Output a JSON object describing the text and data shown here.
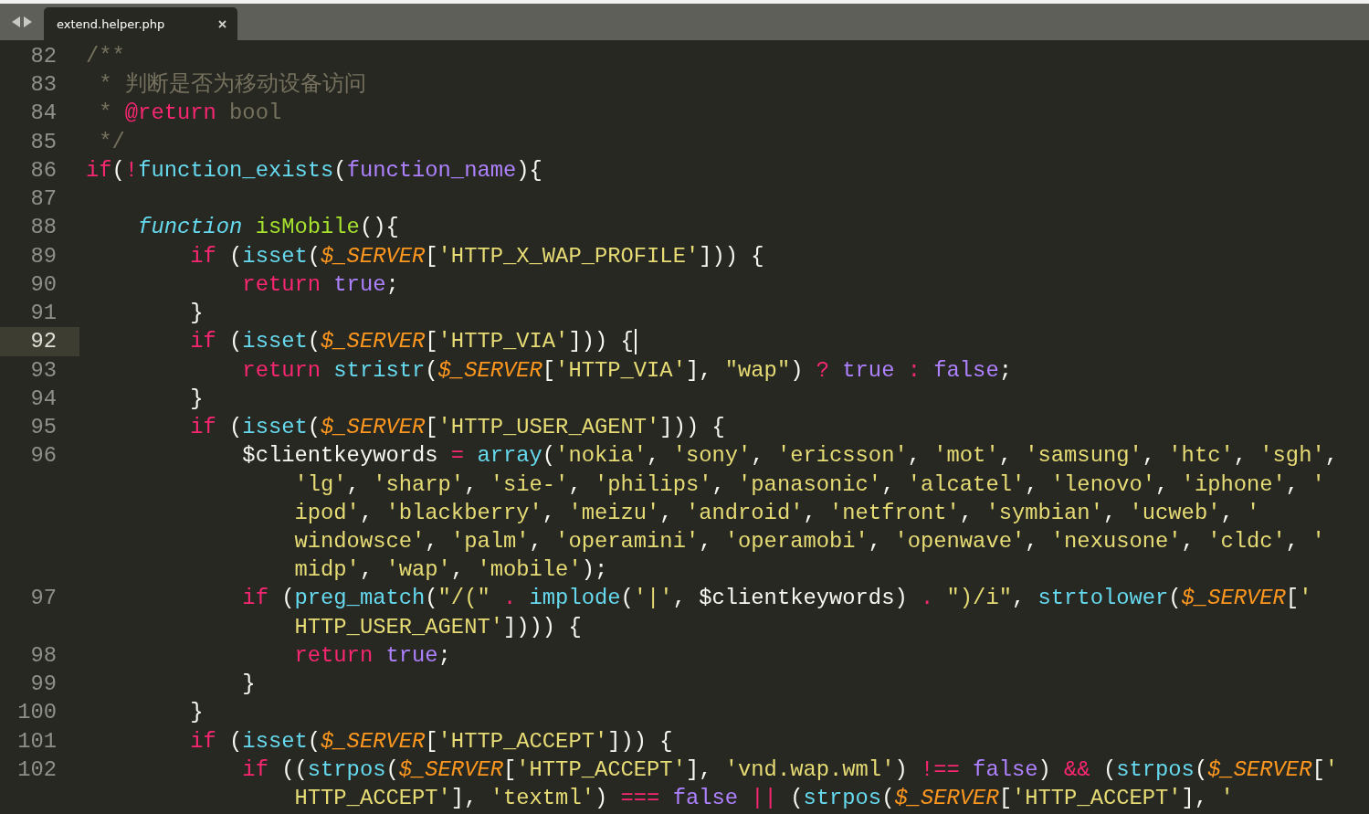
{
  "tabs": [
    {
      "label": "extend.helper.php",
      "selected": true
    }
  ],
  "lines": [
    {
      "number": "82",
      "current": false,
      "rows": [
        {
          "tokens": [
            {
              "kind": "cmt",
              "text": "/**"
            }
          ]
        }
      ]
    },
    {
      "number": "83",
      "current": false,
      "rows": [
        {
          "tokens": [
            {
              "kind": "cmtcont",
              "text": "* 判断是否为移动设备访问"
            }
          ]
        }
      ]
    },
    {
      "number": "84",
      "current": false,
      "rows": [
        {
          "tokens": [
            {
              "kind": "cmtcont",
              "text": "* "
            },
            {
              "kind": "tag",
              "text": "@return"
            },
            {
              "kind": "cmt",
              "text": " bool"
            }
          ]
        }
      ]
    },
    {
      "number": "85",
      "current": false,
      "rows": [
        {
          "tokens": [
            {
              "kind": "cmtcont",
              "text": "*/"
            }
          ]
        }
      ]
    },
    {
      "number": "86",
      "current": false,
      "rows": [
        {
          "tokens": [
            {
              "kind": "kw",
              "text": "if"
            },
            {
              "kind": "plain",
              "text": "("
            },
            {
              "kind": "op",
              "text": "!"
            },
            {
              "kind": "fn",
              "text": "function_exists"
            },
            {
              "kind": "plain",
              "text": "("
            },
            {
              "kind": "const",
              "text": "function_name"
            },
            {
              "kind": "plain",
              "text": "){"
            }
          ]
        }
      ],
      "children": [
        {
          "number": "87",
          "current": false
        },
        {
          "number": "88",
          "current": false,
          "rows": [
            {
              "tokens": [
                {
                  "kind": "storage",
                  "text": "function "
                },
                {
                  "kind": "def",
                  "text": "isMobile"
                },
                {
                  "kind": "plain",
                  "text": "(){"
                }
              ]
            }
          ],
          "children": [
            {
              "number": "89",
              "current": false,
              "rows": [
                {
                  "tokens": [
                    {
                      "kind": "kw",
                      "text": "if"
                    },
                    {
                      "kind": "plain",
                      "text": " ("
                    },
                    {
                      "kind": "fn",
                      "text": "isset"
                    },
                    {
                      "kind": "plain",
                      "text": "("
                    },
                    {
                      "kind": "var",
                      "text": "$_SERVER"
                    },
                    {
                      "kind": "plain",
                      "text": "["
                    },
                    {
                      "kind": "str",
                      "text": "'HTTP_X_WAP_PROFILE'"
                    },
                    {
                      "kind": "plain",
                      "text": "])) {"
                    }
                  ]
                }
              ],
              "children": [
                {
                  "number": "90",
                  "current": false,
                  "rows": [
                    {
                      "tokens": [
                        {
                          "kind": "kw",
                          "text": "return "
                        },
                        {
                          "kind": "const",
                          "text": "true"
                        },
                        {
                          "kind": "plain",
                          "text": ";"
                        }
                      ]
                    }
                  ]
                }
              ]
            },
            {
              "number": "91",
              "current": false,
              "rows": [
                {
                  "tokens": [
                    {
                      "kind": "plain",
                      "text": "}"
                    }
                  ]
                }
              ]
            },
            {
              "number": "92",
              "current": true,
              "rows": [
                {
                  "tokens": [
                    {
                      "kind": "kw",
                      "text": "if"
                    },
                    {
                      "kind": "plain",
                      "text": " ("
                    },
                    {
                      "kind": "fn",
                      "text": "isset"
                    },
                    {
                      "kind": "plain",
                      "text": "("
                    },
                    {
                      "kind": "var",
                      "text": "$_SERVER"
                    },
                    {
                      "kind": "plain",
                      "text": "["
                    },
                    {
                      "kind": "str",
                      "text": "'HTTP_VIA'"
                    },
                    {
                      "kind": "plain",
                      "text": "])) {"
                    }
                  ]
                }
              ],
              "children": [
                {
                  "number": "93",
                  "current": false,
                  "rows": [
                    {
                      "tokens": [
                        {
                          "kind": "kw",
                          "text": "return "
                        },
                        {
                          "kind": "fn",
                          "text": "stristr"
                        },
                        {
                          "kind": "plain",
                          "text": "("
                        },
                        {
                          "kind": "var",
                          "text": "$_SERVER"
                        },
                        {
                          "kind": "plain",
                          "text": "["
                        },
                        {
                          "kind": "str",
                          "text": "'HTTP_VIA'"
                        },
                        {
                          "kind": "plain",
                          "text": "], "
                        },
                        {
                          "kind": "str",
                          "text": "\"wap\""
                        },
                        {
                          "kind": "plain",
                          "text": ") "
                        },
                        {
                          "kind": "op",
                          "text": "? "
                        },
                        {
                          "kind": "const",
                          "text": "true "
                        },
                        {
                          "kind": "op",
                          "text": ": "
                        },
                        {
                          "kind": "const",
                          "text": "false"
                        },
                        {
                          "kind": "plain",
                          "text": ";"
                        }
                      ]
                    }
                  ]
                }
              ]
            },
            {
              "number": "94",
              "current": false,
              "rows": [
                {
                  "tokens": [
                    {
                      "kind": "plain",
                      "text": "}"
                    }
                  ]
                }
              ]
            },
            {
              "number": "95",
              "current": false,
              "rows": [
                {
                  "tokens": [
                    {
                      "kind": "kw",
                      "text": "if"
                    },
                    {
                      "kind": "plain",
                      "text": " ("
                    },
                    {
                      "kind": "fn",
                      "text": "isset"
                    },
                    {
                      "kind": "plain",
                      "text": "("
                    },
                    {
                      "kind": "var",
                      "text": "$_SERVER"
                    },
                    {
                      "kind": "plain",
                      "text": "["
                    },
                    {
                      "kind": "str",
                      "text": "'HTTP_USER_AGENT'"
                    },
                    {
                      "kind": "plain",
                      "text": "])) {"
                    }
                  ]
                }
              ],
              "children": [
                {
                  "number": "96",
                  "current": false,
                  "rows": [
                    {
                      "tokens": [
                        {
                          "kind": "plain",
                          "text": "$clientkeywords "
                        },
                        {
                          "kind": "op",
                          "text": "= "
                        },
                        {
                          "kind": "fn",
                          "text": "array"
                        },
                        {
                          "kind": "plain",
                          "text": "("
                        },
                        {
                          "kind": "str",
                          "text": "'nokia'"
                        },
                        {
                          "kind": "plain",
                          "text": ", "
                        },
                        {
                          "kind": "str",
                          "text": "'sony'"
                        },
                        {
                          "kind": "plain",
                          "text": ", "
                        },
                        {
                          "kind": "str",
                          "text": "'ericsson'"
                        },
                        {
                          "kind": "plain",
                          "text": ", "
                        },
                        {
                          "kind": "str",
                          "text": "'mot'"
                        },
                        {
                          "kind": "plain",
                          "text": ", "
                        },
                        {
                          "kind": "str",
                          "text": "'samsung'"
                        },
                        {
                          "kind": "plain",
                          "text": ", "
                        },
                        {
                          "kind": "str",
                          "text": "'htc'"
                        },
                        {
                          "kind": "plain",
                          "text": ", "
                        },
                        {
                          "kind": "str",
                          "text": "'sgh'"
                        },
                        {
                          "kind": "plain",
                          "text": ","
                        }
                      ]
                    },
                    {
                      "tokens": [
                        {
                          "kind": "str",
                          "text": "'lg'"
                        },
                        {
                          "kind": "plain",
                          "text": ", "
                        },
                        {
                          "kind": "str",
                          "text": "'sharp'"
                        },
                        {
                          "kind": "plain",
                          "text": ", "
                        },
                        {
                          "kind": "str",
                          "text": "'sie-'"
                        },
                        {
                          "kind": "plain",
                          "text": ", "
                        },
                        {
                          "kind": "str",
                          "text": "'philips'"
                        },
                        {
                          "kind": "plain",
                          "text": ", "
                        },
                        {
                          "kind": "str",
                          "text": "'panasonic'"
                        },
                        {
                          "kind": "plain",
                          "text": ", "
                        },
                        {
                          "kind": "str",
                          "text": "'alcatel'"
                        },
                        {
                          "kind": "plain",
                          "text": ", "
                        },
                        {
                          "kind": "str",
                          "text": "'lenovo'"
                        },
                        {
                          "kind": "plain",
                          "text": ", "
                        },
                        {
                          "kind": "str",
                          "text": "'iphone'"
                        },
                        {
                          "kind": "plain",
                          "text": ", "
                        },
                        {
                          "kind": "str",
                          "text": "'"
                        }
                      ]
                    },
                    {
                      "tokens": [
                        {
                          "kind": "str",
                          "text": "ipod'"
                        },
                        {
                          "kind": "plain",
                          "text": ", "
                        },
                        {
                          "kind": "str",
                          "text": "'blackberry'"
                        },
                        {
                          "kind": "plain",
                          "text": ", "
                        },
                        {
                          "kind": "str",
                          "text": "'meizu'"
                        },
                        {
                          "kind": "plain",
                          "text": ", "
                        },
                        {
                          "kind": "str",
                          "text": "'android'"
                        },
                        {
                          "kind": "plain",
                          "text": ", "
                        },
                        {
                          "kind": "str",
                          "text": "'netfront'"
                        },
                        {
                          "kind": "plain",
                          "text": ", "
                        },
                        {
                          "kind": "str",
                          "text": "'symbian'"
                        },
                        {
                          "kind": "plain",
                          "text": ", "
                        },
                        {
                          "kind": "str",
                          "text": "'ucweb'"
                        },
                        {
                          "kind": "plain",
                          "text": ", "
                        },
                        {
                          "kind": "str",
                          "text": "'"
                        }
                      ]
                    },
                    {
                      "tokens": [
                        {
                          "kind": "str",
                          "text": "windowsce'"
                        },
                        {
                          "kind": "plain",
                          "text": ", "
                        },
                        {
                          "kind": "str",
                          "text": "'palm'"
                        },
                        {
                          "kind": "plain",
                          "text": ", "
                        },
                        {
                          "kind": "str",
                          "text": "'operamini'"
                        },
                        {
                          "kind": "plain",
                          "text": ", "
                        },
                        {
                          "kind": "str",
                          "text": "'operamobi'"
                        },
                        {
                          "kind": "plain",
                          "text": ", "
                        },
                        {
                          "kind": "str",
                          "text": "'openwave'"
                        },
                        {
                          "kind": "plain",
                          "text": ", "
                        },
                        {
                          "kind": "str",
                          "text": "'nexusone'"
                        },
                        {
                          "kind": "plain",
                          "text": ", "
                        },
                        {
                          "kind": "str",
                          "text": "'cldc'"
                        },
                        {
                          "kind": "plain",
                          "text": ", "
                        },
                        {
                          "kind": "str",
                          "text": "'"
                        }
                      ]
                    },
                    {
                      "tokens": [
                        {
                          "kind": "str",
                          "text": "midp'"
                        },
                        {
                          "kind": "plain",
                          "text": ", "
                        },
                        {
                          "kind": "str",
                          "text": "'wap'"
                        },
                        {
                          "kind": "plain",
                          "text": ", "
                        },
                        {
                          "kind": "str",
                          "text": "'mobile'"
                        },
                        {
                          "kind": "plain",
                          "text": ");"
                        }
                      ]
                    }
                  ]
                },
                {
                  "number": "97",
                  "current": false,
                  "rows": [
                    {
                      "tokens": [
                        {
                          "kind": "kw",
                          "text": "if"
                        },
                        {
                          "kind": "plain",
                          "text": " ("
                        },
                        {
                          "kind": "fn",
                          "text": "preg_match"
                        },
                        {
                          "kind": "plain",
                          "text": "("
                        },
                        {
                          "kind": "str",
                          "text": "\"/(\" "
                        },
                        {
                          "kind": "op",
                          "text": ". "
                        },
                        {
                          "kind": "fn",
                          "text": "implode"
                        },
                        {
                          "kind": "plain",
                          "text": "("
                        },
                        {
                          "kind": "str",
                          "text": "'|'"
                        },
                        {
                          "kind": "plain",
                          "text": ", $clientkeywords) "
                        },
                        {
                          "kind": "op",
                          "text": ". "
                        },
                        {
                          "kind": "str",
                          "text": "\")/i\""
                        },
                        {
                          "kind": "plain",
                          "text": ", "
                        },
                        {
                          "kind": "fn",
                          "text": "strtolower"
                        },
                        {
                          "kind": "plain",
                          "text": "("
                        },
                        {
                          "kind": "var",
                          "text": "$_SERVER"
                        },
                        {
                          "kind": "plain",
                          "text": "["
                        },
                        {
                          "kind": "str",
                          "text": "'"
                        }
                      ]
                    },
                    {
                      "tokens": [
                        {
                          "kind": "str",
                          "text": "HTTP_USER_AGENT'"
                        },
                        {
                          "kind": "plain",
                          "text": "]))) {"
                        }
                      ]
                    }
                  ],
                  "children": [
                    {
                      "number": "98",
                      "current": false,
                      "rows": [
                        {
                          "tokens": [
                            {
                              "kind": "kw",
                              "text": "return "
                            },
                            {
                              "kind": "const",
                              "text": "true"
                            },
                            {
                              "kind": "plain",
                              "text": ";"
                            }
                          ]
                        }
                      ]
                    }
                  ]
                },
                {
                  "number": "99",
                  "current": false,
                  "rows": [
                    {
                      "tokens": [
                        {
                          "kind": "plain",
                          "text": "}"
                        }
                      ]
                    }
                  ]
                }
              ]
            },
            {
              "number": "100",
              "current": false,
              "rows": [
                {
                  "tokens": [
                    {
                      "kind": "plain",
                      "text": "}"
                    }
                  ]
                }
              ]
            },
            {
              "number": "101",
              "current": false,
              "rows": [
                {
                  "tokens": [
                    {
                      "kind": "kw",
                      "text": "if"
                    },
                    {
                      "kind": "plain",
                      "text": " ("
                    },
                    {
                      "kind": "fn",
                      "text": "isset"
                    },
                    {
                      "kind": "plain",
                      "text": "("
                    },
                    {
                      "kind": "var",
                      "text": "$_SERVER"
                    },
                    {
                      "kind": "plain",
                      "text": "["
                    },
                    {
                      "kind": "str",
                      "text": "'HTTP_ACCEPT'"
                    },
                    {
                      "kind": "plain",
                      "text": "])) {"
                    }
                  ]
                }
              ],
              "children": [
                {
                  "number": "102",
                  "current": false,
                  "rows": [
                    {
                      "tokens": [
                        {
                          "kind": "kw",
                          "text": "if"
                        },
                        {
                          "kind": "plain",
                          "text": " (("
                        },
                        {
                          "kind": "fn",
                          "text": "strpos"
                        },
                        {
                          "kind": "plain",
                          "text": "("
                        },
                        {
                          "kind": "var",
                          "text": "$_SERVER"
                        },
                        {
                          "kind": "plain",
                          "text": "["
                        },
                        {
                          "kind": "str",
                          "text": "'HTTP_ACCEPT'"
                        },
                        {
                          "kind": "plain",
                          "text": "], "
                        },
                        {
                          "kind": "str",
                          "text": "'vnd.wap.wml'"
                        },
                        {
                          "kind": "plain",
                          "text": ") "
                        },
                        {
                          "kind": "op",
                          "text": "!== "
                        },
                        {
                          "kind": "const",
                          "text": "false"
                        },
                        {
                          "kind": "plain",
                          "text": ") "
                        },
                        {
                          "kind": "op",
                          "text": "&&"
                        },
                        {
                          "kind": "plain",
                          "text": " ("
                        },
                        {
                          "kind": "fn",
                          "text": "strpos"
                        },
                        {
                          "kind": "plain",
                          "text": "("
                        },
                        {
                          "kind": "var",
                          "text": "$_SERVER"
                        },
                        {
                          "kind": "plain",
                          "text": "["
                        },
                        {
                          "kind": "str",
                          "text": "'"
                        }
                      ]
                    },
                    {
                      "tokens": [
                        {
                          "kind": "str",
                          "text": "HTTP_ACCEPT'"
                        },
                        {
                          "kind": "plain",
                          "text": "], "
                        },
                        {
                          "kind": "str",
                          "text": "'textml'"
                        },
                        {
                          "kind": "plain",
                          "text": ") "
                        },
                        {
                          "kind": "op",
                          "text": "=== "
                        },
                        {
                          "kind": "const",
                          "text": "false "
                        },
                        {
                          "kind": "op",
                          "text": "||"
                        },
                        {
                          "kind": "plain",
                          "text": " ("
                        },
                        {
                          "kind": "fn",
                          "text": "strpos"
                        },
                        {
                          "kind": "plain",
                          "text": "("
                        },
                        {
                          "kind": "var",
                          "text": "$_SERVER"
                        },
                        {
                          "kind": "plain",
                          "text": "["
                        },
                        {
                          "kind": "str",
                          "text": "'HTTP_ACCEPT'"
                        },
                        {
                          "kind": "plain",
                          "text": "], "
                        },
                        {
                          "kind": "str",
                          "text": "'"
                        }
                      ]
                    }
                  ]
                }
              ]
            }
          ]
        }
      ]
    }
  ]
}
